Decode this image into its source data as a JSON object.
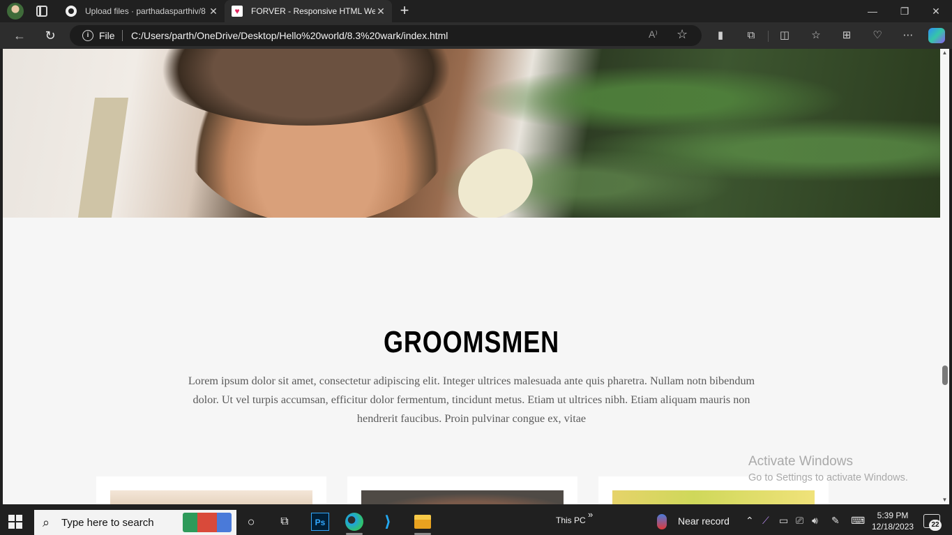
{
  "browser": {
    "tabs": [
      {
        "title": "Upload files · parthadasparthiv/8",
        "favicon": "github-icon",
        "active": false
      },
      {
        "title": "FORVER - Responsive HTML Wed",
        "favicon": "heart-icon",
        "active": true
      }
    ],
    "address": {
      "scheme_label": "File",
      "url": "C:/Users/parth/OneDrive/Desktop/Hello%20world/8.3%20wark/index.html"
    }
  },
  "page": {
    "section_title": "GROOMSMEN",
    "lead": "Lorem ipsum dolor sit amet, consectetur adipiscing elit. Integer ultrices malesuada ante quis pharetra. Nullam notn bibendum dolor. Ut vel turpis accumsan, efficitur dolor fermentum, tincidunt metus. Etiam ut ultrices nibh. Etiam aliquam mauris non hendrerit faucibus. Proin pulvinar congue ex, vitae",
    "cards": [
      {
        "photo": "groomsman-photo-1"
      },
      {
        "photo": "groomsman-photo-2"
      },
      {
        "photo": "groomsman-photo-3"
      }
    ]
  },
  "watermark": {
    "title": "Activate Windows",
    "subtitle": "Go to Settings to activate Windows."
  },
  "taskbar": {
    "search_placeholder": "Type here to search",
    "location_label": "This PC",
    "location_chevron": "»",
    "weather_text": "Near record",
    "time": "5:39 PM",
    "date": "12/18/2023",
    "notification_count": "22",
    "ps_label": "Ps"
  },
  "colors": {
    "page_background": "#f6f6f6",
    "title_color": "#000000",
    "lead_color": "#5a5a5a",
    "chrome_dark": "#202020"
  }
}
